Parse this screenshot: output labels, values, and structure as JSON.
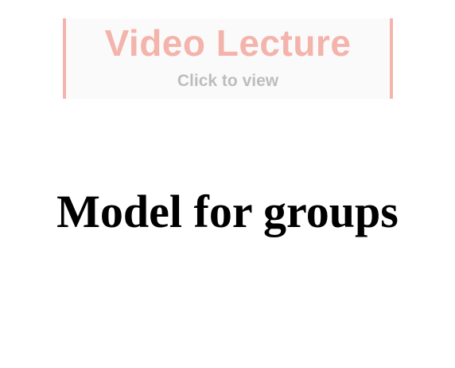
{
  "video_banner": {
    "title": "Video Lecture",
    "subtitle": "Click to view",
    "accent_color": "#f4b3ab",
    "subtitle_color": "#bdbdbd"
  },
  "main": {
    "heading": "Model for groups"
  }
}
